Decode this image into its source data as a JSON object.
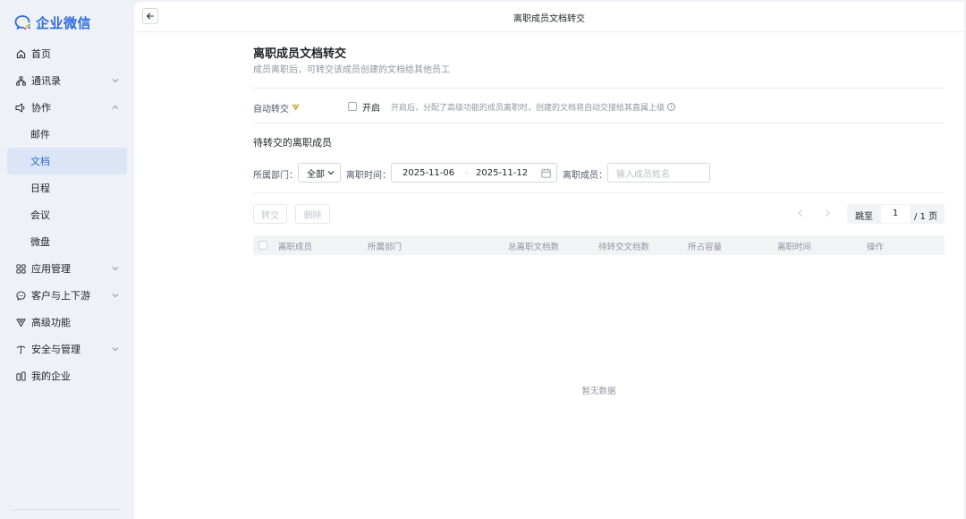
{
  "app": {
    "name": "企业微信"
  },
  "sidebar": {
    "items": [
      {
        "label": "首页",
        "icon": "home-icon"
      },
      {
        "label": "通讯录",
        "icon": "org-icon"
      },
      {
        "label": "协作",
        "icon": "collab-icon"
      },
      {
        "label": "邮件"
      },
      {
        "label": "文档"
      },
      {
        "label": "日程"
      },
      {
        "label": "会议"
      },
      {
        "label": "微盘"
      },
      {
        "label": "应用管理",
        "icon": "apps-icon"
      },
      {
        "label": "客户与上下游",
        "icon": "chat-icon"
      },
      {
        "label": "高级功能",
        "icon": "premium-icon"
      },
      {
        "label": "安全与管理",
        "icon": "shield-icon"
      },
      {
        "label": "我的企业",
        "icon": "company-icon"
      }
    ],
    "active": "文档"
  },
  "header": {
    "title": "离职成员文档转交"
  },
  "page": {
    "title": "离职成员文档转交",
    "description": "成员离职后，可转交该成员创建的文档给其他员工",
    "auto_transfer": {
      "label": "自动转交",
      "toggle_label": "开启",
      "description": "开启后，分配了高级功能的成员离职时，创建的文档将自动交接给其直属上级"
    },
    "section_title": "待转交的离职成员",
    "filters": {
      "department_label": "所属部门：",
      "department_value": "全部",
      "time_label": "离职时间：",
      "start_date": "2025-11-06",
      "range_separator": "-",
      "end_date": "2025-11-12",
      "member_label": "离职成员：",
      "member_placeholder": "输入成员姓名"
    },
    "actions": {
      "transfer": "转交",
      "delete": "删除"
    },
    "pager": {
      "jump_label": "跳至",
      "page": "1",
      "total": "/ 1 页"
    },
    "table": {
      "columns": [
        "离职成员",
        "所属部门",
        "总离职文档数",
        "待转交文档数",
        "所占容量",
        "离职时间",
        "操作"
      ],
      "empty_text": "暂无数据"
    }
  },
  "colors": {
    "accent": "#2d6ce0",
    "premium": "#c9a227"
  }
}
